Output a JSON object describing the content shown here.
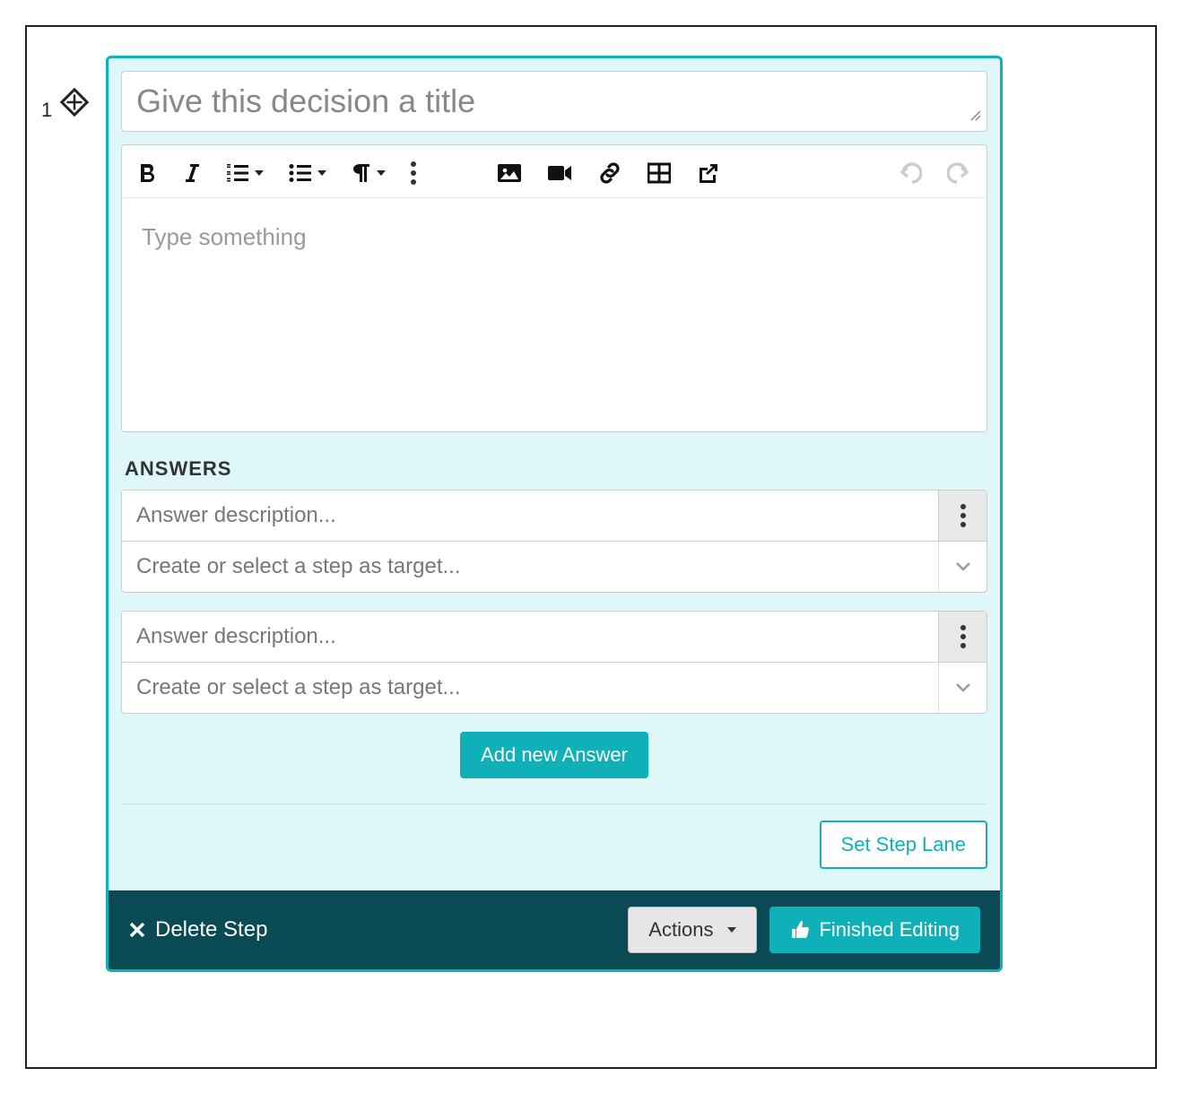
{
  "step_index": "1",
  "title": {
    "placeholder": "Give this decision a title",
    "value": ""
  },
  "editor": {
    "placeholder": "Type something"
  },
  "toolbar_icons": {
    "bold": "bold-icon",
    "italic": "italic-icon",
    "ordered_list": "ordered-list-icon",
    "unordered_list": "unordered-list-icon",
    "paragraph": "paragraph-icon",
    "more": "more-icon",
    "image": "image-icon",
    "video": "video-icon",
    "link": "link-icon",
    "table": "table-icon",
    "external": "external-link-icon",
    "undo": "undo-icon",
    "redo": "redo-icon"
  },
  "answers": {
    "heading": "ANSWERS",
    "items": [
      {
        "description_placeholder": "Answer description...",
        "target_placeholder": "Create or select a step as target..."
      },
      {
        "description_placeholder": "Answer description...",
        "target_placeholder": "Create or select a step as target..."
      }
    ],
    "add_button_label": "Add new Answer"
  },
  "set_lane_label": "Set Step Lane",
  "footer": {
    "delete_label": "Delete Step",
    "actions_label": "Actions",
    "finished_label": "Finished Editing"
  },
  "colors": {
    "teal": "#0fb0b8",
    "darkteal": "#0a4a54",
    "panel_bg": "#e0f7fa"
  }
}
